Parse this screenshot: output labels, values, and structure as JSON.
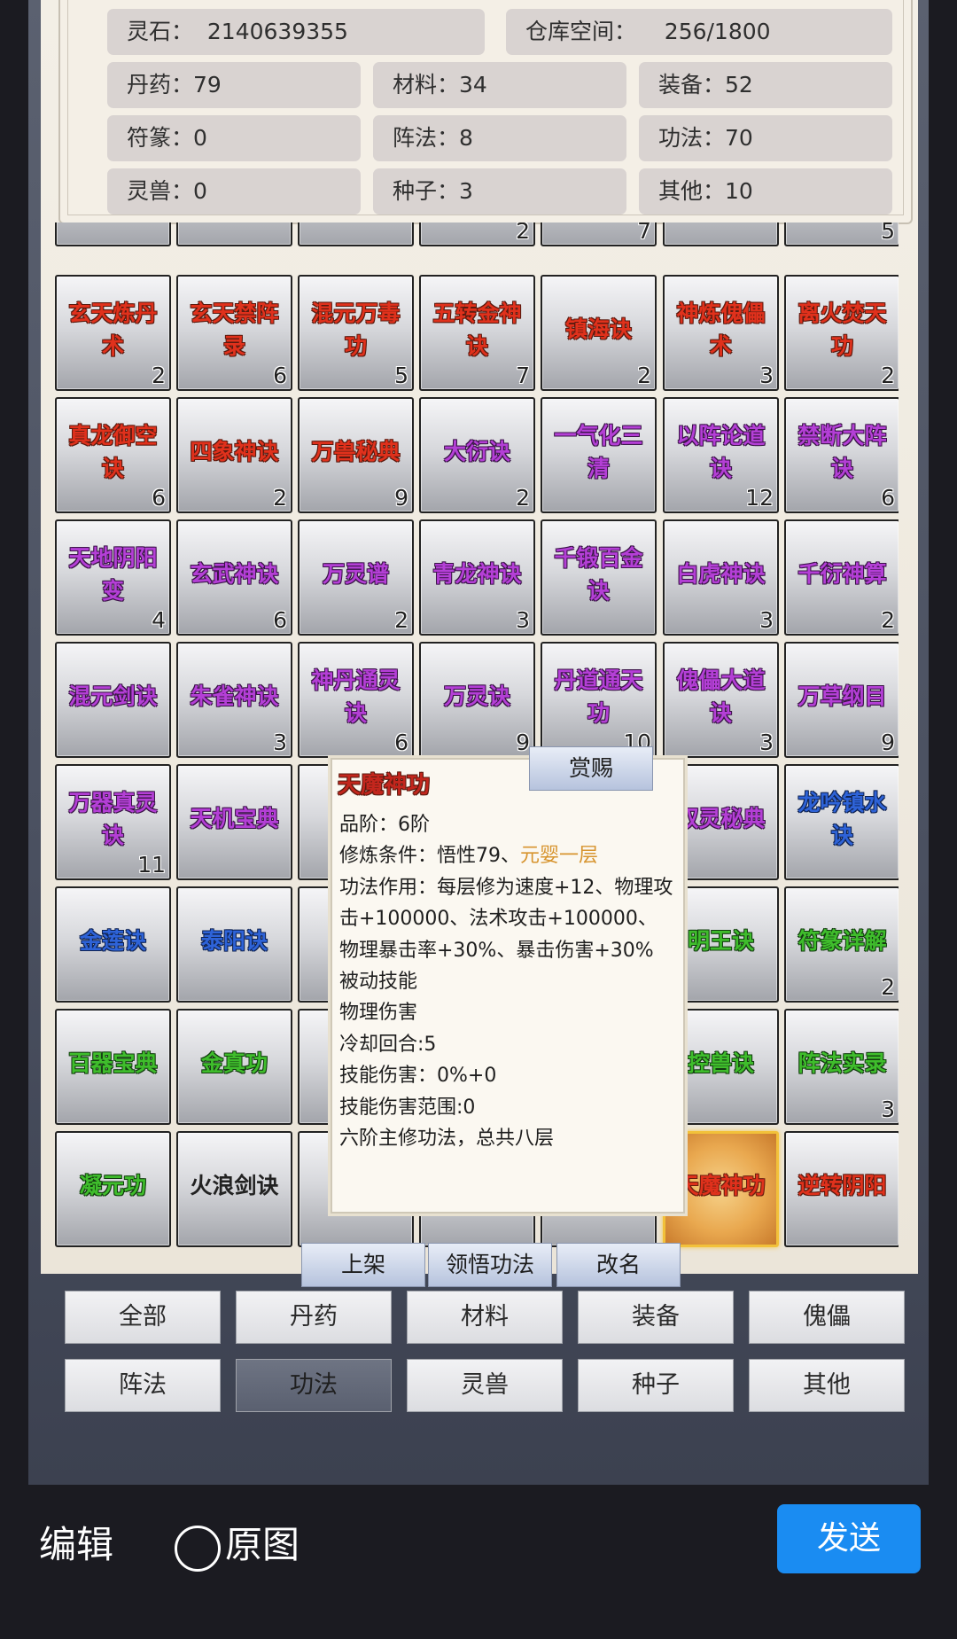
{
  "stats": {
    "spirit_stone": "灵石：  2140639355",
    "storage": "仓库空间：    256/1800",
    "counts": [
      "丹药：79",
      "材料：34",
      "装备：52",
      "符篆：0",
      "阵法：8",
      "功法：70",
      "灵兽：0",
      "种子：3",
      "其他：10"
    ]
  },
  "grid": {
    "partial_row_counts": [
      "",
      "",
      "",
      "2",
      "7",
      "",
      "5"
    ],
    "rows": [
      [
        {
          "name": "玄天炼丹术",
          "count": "2",
          "color": "r"
        },
        {
          "name": "玄天禁阵录",
          "count": "6",
          "color": "r"
        },
        {
          "name": "混元万毒功",
          "count": "5",
          "color": "r"
        },
        {
          "name": "五转金神诀",
          "count": "7",
          "color": "r"
        },
        {
          "name": "镇海诀",
          "count": "2",
          "color": "r"
        },
        {
          "name": "神炼傀儡术",
          "count": "3",
          "color": "r"
        },
        {
          "name": "离火焚天功",
          "count": "2",
          "color": "r"
        }
      ],
      [
        {
          "name": "真龙御空诀",
          "count": "6",
          "color": "r"
        },
        {
          "name": "四象神诀",
          "count": "2",
          "color": "r"
        },
        {
          "name": "万兽秘典",
          "count": "9",
          "color": "r"
        },
        {
          "name": "大衍诀",
          "count": "2",
          "color": "p"
        },
        {
          "name": "一气化三清",
          "count": "",
          "color": "p"
        },
        {
          "name": "以阵论道诀",
          "count": "12",
          "color": "p"
        },
        {
          "name": "禁断大阵诀",
          "count": "6",
          "color": "p"
        }
      ],
      [
        {
          "name": "天地阴阳变",
          "count": "4",
          "color": "p"
        },
        {
          "name": "玄武神诀",
          "count": "6",
          "color": "p"
        },
        {
          "name": "万灵谱",
          "count": "2",
          "color": "p"
        },
        {
          "name": "青龙神诀",
          "count": "3",
          "color": "p"
        },
        {
          "name": "千锻百金诀",
          "count": "",
          "color": "p"
        },
        {
          "name": "白虎神诀",
          "count": "3",
          "color": "p"
        },
        {
          "name": "千衍神算",
          "count": "2",
          "color": "p"
        }
      ],
      [
        {
          "name": "混元剑诀",
          "count": "",
          "color": "p"
        },
        {
          "name": "朱雀神诀",
          "count": "3",
          "color": "p"
        },
        {
          "name": "神丹通灵诀",
          "count": "6",
          "color": "p"
        },
        {
          "name": "万灵诀",
          "count": "9",
          "color": "p"
        },
        {
          "name": "丹道通天功",
          "count": "10",
          "color": "p"
        },
        {
          "name": "傀儡大道诀",
          "count": "3",
          "color": "p"
        },
        {
          "name": "万草纲目",
          "count": "9",
          "color": "p"
        }
      ],
      [
        {
          "name": "万器真灵诀",
          "count": "11",
          "color": "p"
        },
        {
          "name": "天机宝典",
          "count": "",
          "color": "p"
        },
        {
          "name": "",
          "count": "",
          "color": "p"
        },
        {
          "name": "",
          "count": "",
          "color": "p"
        },
        {
          "name": "",
          "count": "",
          "color": "p"
        },
        {
          "name": "驭灵秘典",
          "count": "",
          "color": "p"
        },
        {
          "name": "龙吟镇水诀",
          "count": "",
          "color": "b"
        }
      ],
      [
        {
          "name": "金莲诀",
          "count": "",
          "color": "b"
        },
        {
          "name": "泰阳诀",
          "count": "",
          "color": "b"
        },
        {
          "name": "",
          "count": "",
          "color": "b"
        },
        {
          "name": "",
          "count": "",
          "color": "b"
        },
        {
          "name": "",
          "count": "",
          "color": "b"
        },
        {
          "name": "明王诀",
          "count": "",
          "color": "g"
        },
        {
          "name": "符篆详解",
          "count": "2",
          "color": "g"
        }
      ],
      [
        {
          "name": "百器宝典",
          "count": "",
          "color": "g"
        },
        {
          "name": "金真功",
          "count": "",
          "color": "g"
        },
        {
          "name": "",
          "count": "",
          "color": "g"
        },
        {
          "name": "",
          "count": "",
          "color": "g"
        },
        {
          "name": "",
          "count": "",
          "color": "g"
        },
        {
          "name": "控兽诀",
          "count": "",
          "color": "g"
        },
        {
          "name": "阵法实录",
          "count": "3",
          "color": "g"
        }
      ],
      [
        {
          "name": "凝元功",
          "count": "",
          "color": "g"
        },
        {
          "name": "火浪剑诀",
          "count": "",
          "color": "w"
        },
        {
          "name": "",
          "count": "",
          "color": "w"
        },
        {
          "name": "",
          "count": "",
          "color": "w"
        },
        {
          "name": "",
          "count": "",
          "color": "w"
        },
        {
          "name": "天魔神功",
          "count": "",
          "color": "r",
          "selected": true
        },
        {
          "name": "逆转阴阳",
          "count": "",
          "color": "r"
        }
      ]
    ]
  },
  "popup": {
    "title": "天魔神功",
    "grade": "品阶：6阶",
    "requirement_prefix": "修炼条件：悟性79、",
    "requirement_highlight": "元婴一层",
    "effect": "功法作用：每层修为速度+12、物理攻击+100000、法术攻击+100000、物理暴击率+30%、暴击伤害+30%",
    "passive": "被动技能",
    "damage_type": "物理伤害",
    "cooldown": "冷却回合:5",
    "skill_damage": "技能伤害：0%+0",
    "skill_range": "技能伤害范围:0",
    "note": "六阶主修功法，总共八层",
    "reward_button": "赏赐",
    "list_button": "上架",
    "comprehend_button": "领悟功法",
    "rename_button": "改名"
  },
  "tabs": {
    "row1": [
      "全部",
      "丹药",
      "材料",
      "装备",
      "傀儡"
    ],
    "row2": [
      "阵法",
      "功法",
      "灵兽",
      "种子",
      "其他"
    ],
    "active": "功法"
  },
  "bottom": {
    "edit": "编辑",
    "original": "原图",
    "send": "发送"
  },
  "colors": {
    "send_button": "#1a8cf2",
    "selected_border": "#f2c13a",
    "highlight_text": "#d7942e"
  }
}
